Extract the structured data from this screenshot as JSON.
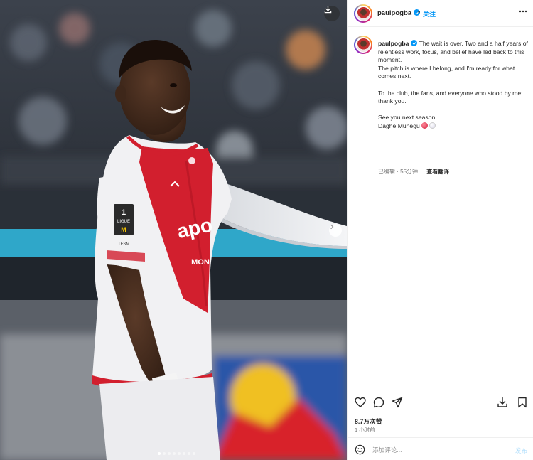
{
  "post": {
    "username": "paulpogba",
    "follow_label": "关注",
    "separator": "•",
    "caption": {
      "username": "paulpogba",
      "lines": [
        "The wait is over. Two and a half years of relentless work, focus, and belief have led back to this moment.",
        "The pitch is where I belong, and I'm ready for what comes next.",
        "",
        "To the club, the fans, and everyone who stood by me: thank you.",
        "",
        "See you next season,",
        "Daghe Munegu"
      ]
    },
    "meta": {
      "edited": "已编辑",
      "dot": "·",
      "ago": "55分钟",
      "translate": "查看翻译"
    },
    "likes": "8.7万次赞",
    "time": "1 小时前",
    "comment": {
      "placeholder": "添加评论...",
      "value": "",
      "post_label": "发布"
    }
  },
  "media": {
    "slide_index": 1,
    "slide_count": 8,
    "jersey_text": "apo",
    "jersey_sub": "MON",
    "patch_top": "1",
    "patch_label": "LIGUE",
    "patch_bottom": "M",
    "sleeve_tag": "TFSM"
  },
  "icons": {
    "download": "download-icon",
    "next": "chevron-right-icon",
    "more": "more-horizontal-icon",
    "verified": "verified-badge-icon",
    "like": "heart-icon",
    "comment": "comment-icon",
    "share": "send-icon",
    "save": "bookmark-icon",
    "emoji": "smiley-icon"
  },
  "colors": {
    "accent": "#0095f6",
    "jersey_red": "#d21f2e",
    "background": "#ffffff"
  }
}
